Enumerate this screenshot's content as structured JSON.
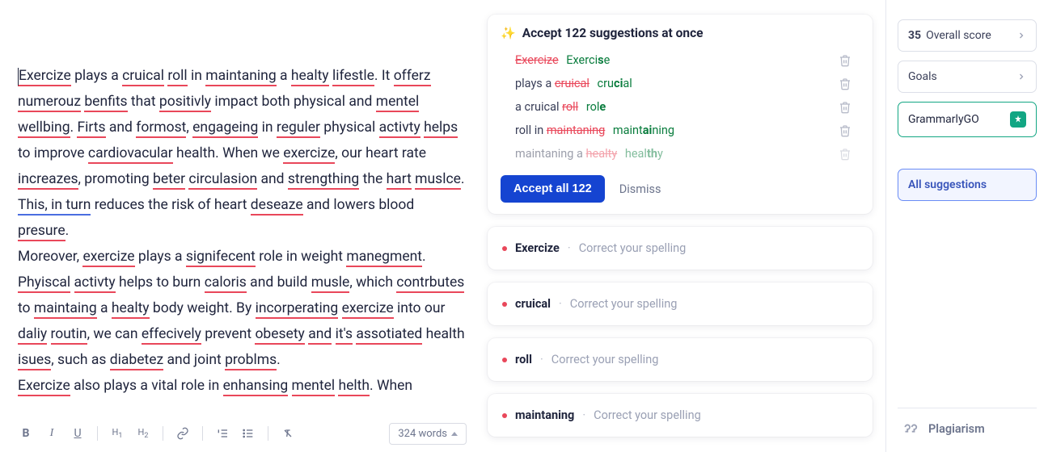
{
  "editor": {
    "word_count": "324 words"
  },
  "accept_card": {
    "title": "Accept 122 suggestions at once",
    "accept_btn": "Accept all 122",
    "dismiss": "Dismiss",
    "items": [
      {
        "context_before": "",
        "strike": "Exercize",
        "context_after": "",
        "replacement_pre": "Exerci",
        "replacement_bold": "s",
        "replacement_post": "e"
      },
      {
        "context_before": "plays a ",
        "strike": "cruical",
        "context_after": "",
        "replacement_pre": "cru",
        "replacement_bold": "ci",
        "replacement_post": "al"
      },
      {
        "context_before": "a cruical ",
        "strike": "roll",
        "context_after": "",
        "replacement_pre": "rol",
        "replacement_bold": "e",
        "replacement_post": ""
      },
      {
        "context_before": "roll in ",
        "strike": "maintaning",
        "context_after": "",
        "replacement_pre": "maint",
        "replacement_bold": "ai",
        "replacement_post": "ning"
      },
      {
        "context_before": "maintaning a ",
        "strike": "healty",
        "context_after": "",
        "replacement_pre": "heal",
        "replacement_bold": "th",
        "replacement_post": "y",
        "faded": true
      }
    ]
  },
  "spell_cards": [
    {
      "word": "Exercize",
      "hint": "Correct your spelling"
    },
    {
      "word": "cruical",
      "hint": "Correct your spelling"
    },
    {
      "word": "roll",
      "hint": "Correct your spelling"
    },
    {
      "word": "maintaning",
      "hint": "Correct your spelling"
    }
  ],
  "sidebar": {
    "score_num": "35",
    "score_label": " Overall score",
    "goals": "Goals",
    "go": "GrammarlyGO",
    "allsugg": "All suggestions",
    "plagiarism": "Plagiarism"
  },
  "text": {
    "p1": [
      {
        "t": "Exercize",
        "u": 1
      },
      {
        "t": " plays a "
      },
      {
        "t": "cruical",
        "u": 1
      },
      {
        "t": " "
      },
      {
        "t": "roll",
        "u": 1
      },
      {
        "t": " in "
      },
      {
        "t": "maintaning",
        "u": 1
      },
      {
        "t": " a "
      },
      {
        "t": "healty",
        "u": 1
      },
      {
        "t": " "
      },
      {
        "t": "lifestle",
        "u": 1
      },
      {
        "t": ". It "
      },
      {
        "t": "offerz",
        "u": 1
      },
      {
        "t": " "
      },
      {
        "t": "numerouz",
        "u": 1
      },
      {
        "t": " "
      },
      {
        "t": "benfits",
        "u": 1
      },
      {
        "t": " that "
      },
      {
        "t": "positivly",
        "u": 1
      },
      {
        "t": " impact both physical and "
      },
      {
        "t": "mentel",
        "u": 1
      },
      {
        "t": " "
      },
      {
        "t": "wellbing",
        "u": 1
      },
      {
        "t": ". "
      },
      {
        "t": "Firts",
        "u": 1
      },
      {
        "t": " and "
      },
      {
        "t": "formost",
        "u": 1
      },
      {
        "t": ", "
      },
      {
        "t": "engageing",
        "u": 1
      },
      {
        "t": " in "
      },
      {
        "t": "reguler",
        "u": 1
      },
      {
        "t": " physical "
      },
      {
        "t": "activty",
        "u": 1
      },
      {
        "t": " "
      },
      {
        "t": "helps",
        "u": 1
      },
      {
        "t": " to improve "
      },
      {
        "t": "cardiovacular",
        "u": 1
      },
      {
        "t": " health. When we "
      },
      {
        "t": "exercize",
        "u": 1
      },
      {
        "t": ", our heart rate "
      },
      {
        "t": "increazes",
        "u": 1
      },
      {
        "t": ", promoting "
      },
      {
        "t": "beter",
        "u": 1
      },
      {
        "t": " "
      },
      {
        "t": "circulasion",
        "u": 1
      },
      {
        "t": " and "
      },
      {
        "t": "strengthing",
        "u": 1
      },
      {
        "t": " the "
      },
      {
        "t": "hart",
        "u": 1
      },
      {
        "t": " "
      },
      {
        "t": "muslce",
        "u": 1
      },
      {
        "t": ". "
      },
      {
        "t": "This, in turn",
        "ub": 1
      },
      {
        "t": " reduces the risk of heart "
      },
      {
        "t": "deseaze",
        "u": 1
      },
      {
        "t": " and lowers blood "
      },
      {
        "t": "presure",
        "u": 1
      },
      {
        "t": "."
      }
    ],
    "p2": [
      {
        "t": "Moreover, "
      },
      {
        "t": "exercize",
        "u": 1
      },
      {
        "t": " plays a "
      },
      {
        "t": "signifecent",
        "u": 1
      },
      {
        "t": " role in weight "
      },
      {
        "t": "manegment",
        "u": 1
      },
      {
        "t": ". "
      },
      {
        "t": "Phyiscal",
        "u": 1
      },
      {
        "t": " "
      },
      {
        "t": "activty",
        "u": 1
      },
      {
        "t": " helps to burn "
      },
      {
        "t": "caloris",
        "u": 1
      },
      {
        "t": " and build "
      },
      {
        "t": "musle",
        "u": 1
      },
      {
        "t": ", which "
      },
      {
        "t": "contrbutes",
        "u": 1
      },
      {
        "t": " to "
      },
      {
        "t": "maintaing",
        "u": 1
      },
      {
        "t": " a "
      },
      {
        "t": "healty",
        "u": 1
      },
      {
        "t": " body weight. By "
      },
      {
        "t": "incorperating",
        "u": 1
      },
      {
        "t": " "
      },
      {
        "t": "exercize",
        "u": 1
      },
      {
        "t": " into our "
      },
      {
        "t": "daliy",
        "u": 1
      },
      {
        "t": " "
      },
      {
        "t": "routin",
        "u": 1
      },
      {
        "t": ", we can "
      },
      {
        "t": "effecively",
        "u": 1
      },
      {
        "t": " prevent "
      },
      {
        "t": "obesety",
        "u": 1
      },
      {
        "t": " "
      },
      {
        "t": "and",
        "u": 1
      },
      {
        "t": " "
      },
      {
        "t": "it's",
        "u": 1
      },
      {
        "t": " "
      },
      {
        "t": "assotiated",
        "u": 1
      },
      {
        "t": " health "
      },
      {
        "t": "isues",
        "u": 1
      },
      {
        "t": ", such as "
      },
      {
        "t": "diabetez",
        "u": 1
      },
      {
        "t": " and joint "
      },
      {
        "t": "problms",
        "u": 1
      },
      {
        "t": "."
      }
    ],
    "p3": [
      {
        "t": "Exercize",
        "u": 1
      },
      {
        "t": " also plays a vital role in "
      },
      {
        "t": "enhansing",
        "u": 1
      },
      {
        "t": " "
      },
      {
        "t": "mentel",
        "u": 1
      },
      {
        "t": " "
      },
      {
        "t": "helth",
        "u": 1
      },
      {
        "t": ". When"
      }
    ]
  }
}
